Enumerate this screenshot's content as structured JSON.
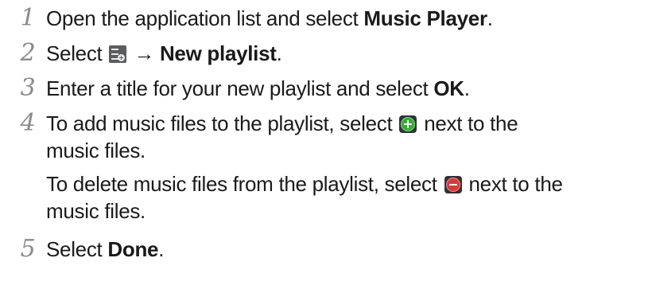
{
  "steps": [
    {
      "number": "1",
      "text1": "Open the application list and select ",
      "bold1": "Music Player",
      "tail1": "."
    },
    {
      "number": "2",
      "text1": "Select ",
      "icon": "playlist-menu-icon",
      "arrow": " → ",
      "bold1": "New playlist",
      "tail1": "."
    },
    {
      "number": "3",
      "text1": "Enter a title for your new playlist and select ",
      "bold1": "OK",
      "tail1": "."
    },
    {
      "number": "4",
      "line1a": "To add music files to the playlist, select ",
      "icon_add": "add-green-icon",
      "line1b": " next to the",
      "line2": "music files.",
      "line3a": "To delete music files from the playlist, select ",
      "icon_del": "delete-red-icon",
      "line3b": " next to the",
      "line4": "music files."
    },
    {
      "number": "5",
      "text1": "Select ",
      "bold1": "Done",
      "tail1": "."
    }
  ]
}
